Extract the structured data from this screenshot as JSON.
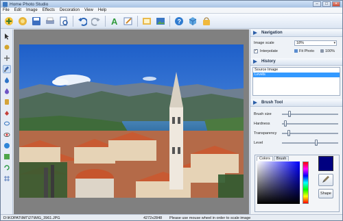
{
  "window": {
    "title": "Home Photo Studio"
  },
  "menu": [
    "File",
    "Edit",
    "Image",
    "Effects",
    "Decoration",
    "View",
    "Help"
  ],
  "toolbar_icons": [
    "new-wizard-icon",
    "open-icon",
    "save-icon",
    "print-icon",
    "print-preview-icon",
    "undo-icon",
    "redo-icon",
    "text-icon",
    "edit-icon",
    "frame-icon",
    "image-icon",
    "help-icon",
    "box-icon",
    "shop-icon"
  ],
  "left_tools": [
    "pointer-icon",
    "crop-icon",
    "move-icon",
    "brush-icon",
    "drop-icon",
    "eraser-icon",
    "clone-icon",
    "fill-icon",
    "lasso-icon",
    "red-eye-icon",
    "palette-icon",
    "transform-icon",
    "rotate-icon",
    "grid-icon"
  ],
  "navigation": {
    "title": "Navigation",
    "scale_label": "Image scale",
    "scale_value": "18%",
    "interpolate_label": "Interpolate",
    "interpolate_checked": true,
    "fit_label": "Fit Photo",
    "full_label": "100%"
  },
  "history": {
    "title": "History",
    "items": [
      {
        "label": "Source Image",
        "selected": false
      },
      {
        "label": "Levels",
        "selected": true
      }
    ]
  },
  "brush": {
    "title": "Brush Tool",
    "sliders": [
      {
        "label": "Brush size",
        "value": 0.12
      },
      {
        "label": "Hardness",
        "value": 0.04
      },
      {
        "label": "Transparency",
        "value": 0.1
      },
      {
        "label": "Level",
        "value": 0.62
      }
    ],
    "tabs": [
      "Colors",
      "Brush"
    ],
    "active_tab": "Colors",
    "color": "#000080",
    "shape_label": "Shape"
  },
  "status": {
    "path": "D:\\KOPAT\\IMГ\\27\\IMG_3961.JPG",
    "dimensions": "4272x2848",
    "hint": "Please use mouse wheel in order to scale image"
  }
}
